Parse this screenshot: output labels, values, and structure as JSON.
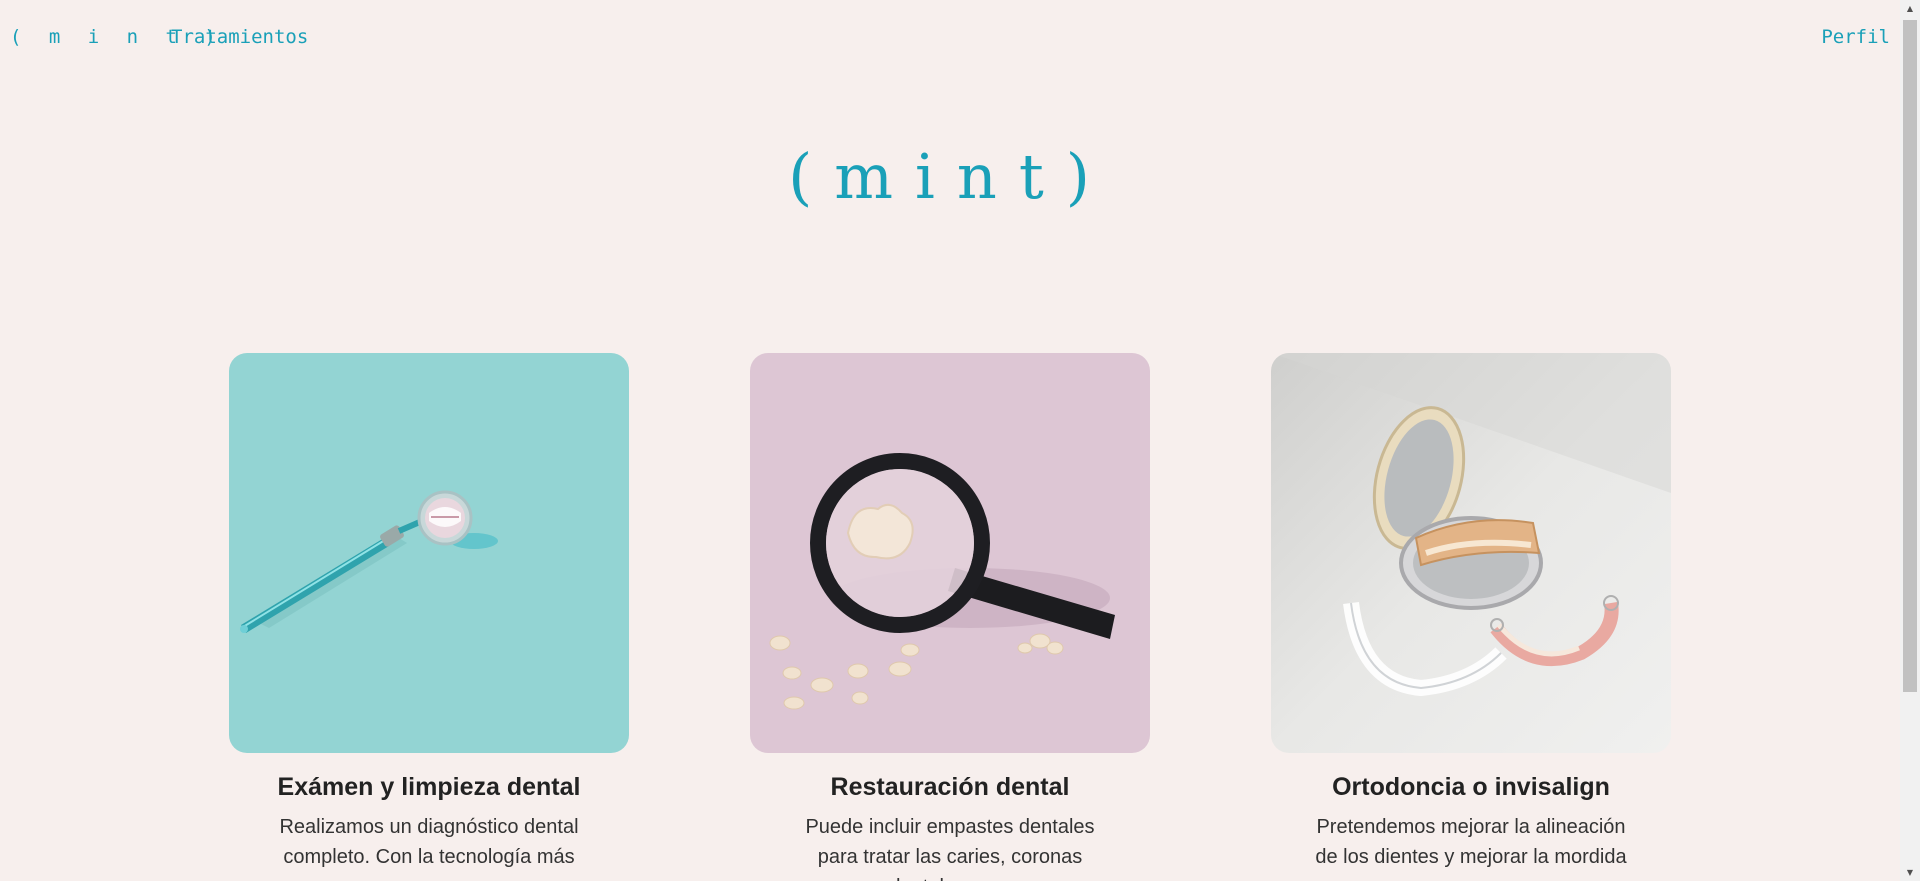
{
  "nav": {
    "logo": "( m i n t )",
    "treatments_link": "Tratamientos",
    "profile_link": "Perfil"
  },
  "hero": {
    "logo": "(mint)"
  },
  "cards": [
    {
      "title": "Exámen y limpieza dental",
      "text": "Realizamos un diagnóstico dental completo. Con la tecnología más",
      "image_bg": "#93d4d3"
    },
    {
      "title": "Restauración dental",
      "text": "Puede incluir empastes dentales para tratar las caries, coronas dentales para",
      "image_bg": "#ddc6d4"
    },
    {
      "title": "Ortodoncia o invisalign",
      "text": "Pretendemos mejorar la alineación de los dientes y mejorar la mordida con",
      "image_bg": "#e3e3e1"
    }
  ],
  "colors": {
    "accent": "#1aa0b8",
    "background": "#f7efed"
  }
}
